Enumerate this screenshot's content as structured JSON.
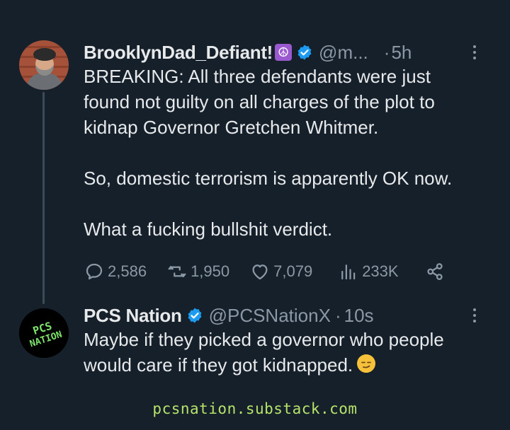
{
  "tweets": [
    {
      "display_name": "BrooklynDad_Defiant!",
      "name_emoji": "☮",
      "handle": "@m...",
      "separator": "·",
      "time": "5h",
      "paragraphs": [
        "BREAKING: All three defendants were just found not guilty on all charges of the plot to kidnap Governor Gretchen Whitmer.",
        "So, domestic terrorism is apparently OK now.",
        "What a fucking bullshit verdict."
      ],
      "stats": {
        "replies": "2,586",
        "retweets": "1,950",
        "likes": "7,079",
        "views": "233K"
      }
    },
    {
      "display_name": "PCS Nation",
      "handle": "@PCSNationX",
      "separator": "·",
      "time": "10s",
      "text": "Maybe if they picked a governor who people would care if they got kidnapped.",
      "avatar_text_line1": "PCS",
      "avatar_text_line2": "NATION"
    }
  ],
  "footer": {
    "url": "pcsnation.substack.com"
  },
  "colors": {
    "background": "#15202b",
    "text": "#e7e9ea",
    "secondary_text": "#8b98a5",
    "verified_blue": "#1d9bf0",
    "footer_green": "#b7e36a"
  }
}
